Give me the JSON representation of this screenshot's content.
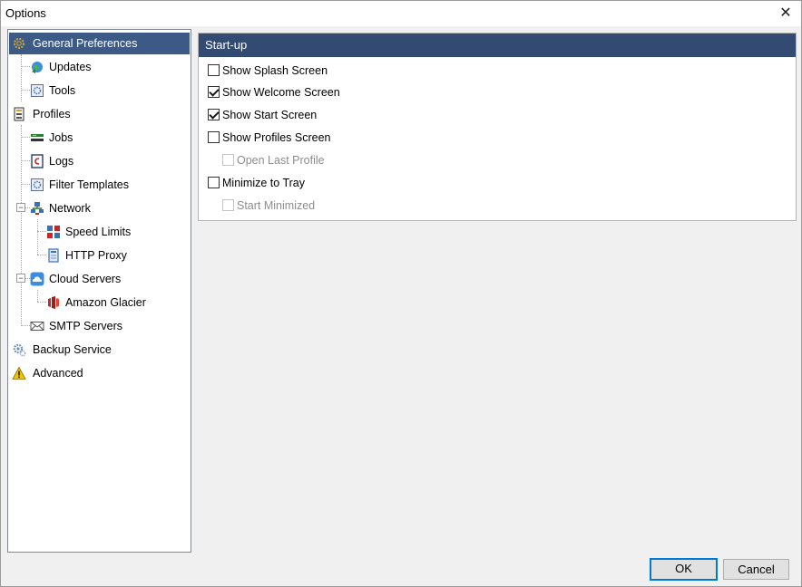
{
  "window": {
    "title": "Options"
  },
  "tree": {
    "items": [
      {
        "label": "General Preferences"
      },
      {
        "label": "Updates"
      },
      {
        "label": "Tools"
      },
      {
        "label": "Profiles"
      },
      {
        "label": "Jobs"
      },
      {
        "label": "Logs"
      },
      {
        "label": "Filter Templates"
      },
      {
        "label": "Network"
      },
      {
        "label": "Speed Limits"
      },
      {
        "label": "HTTP Proxy"
      },
      {
        "label": "Cloud Servers"
      },
      {
        "label": "Amazon Glacier"
      },
      {
        "label": "SMTP Servers"
      },
      {
        "label": "Backup Service"
      },
      {
        "label": "Advanced"
      }
    ],
    "selected": "General Preferences"
  },
  "startup": {
    "header": "Start-up",
    "options": [
      {
        "label": "Show Splash Screen",
        "checked": false,
        "enabled": true
      },
      {
        "label": "Show Welcome Screen",
        "checked": true,
        "enabled": true
      },
      {
        "label": "Show Start Screen",
        "checked": true,
        "enabled": true
      },
      {
        "label": "Show Profiles Screen",
        "checked": false,
        "enabled": true
      },
      {
        "label": "Open Last Profile",
        "checked": false,
        "enabled": false
      },
      {
        "label": "Minimize to Tray",
        "checked": false,
        "enabled": true
      },
      {
        "label": "Start Minimized",
        "checked": false,
        "enabled": false
      }
    ]
  },
  "buttons": {
    "ok": "OK",
    "cancel": "Cancel"
  },
  "colors": {
    "selection": "#3c5a85",
    "header": "#334b72",
    "focus": "#0078d7"
  }
}
